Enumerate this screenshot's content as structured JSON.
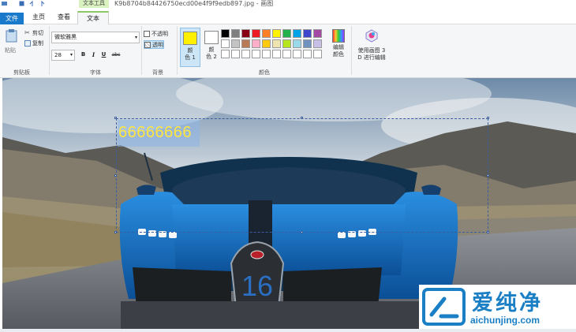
{
  "titlebar": {
    "context_tab_title": "文本工具",
    "document_title": "K9b8704b84426750ecd00e4f9f9edb897.jpg - 画图"
  },
  "tabs": [
    {
      "label": "文件"
    },
    {
      "label": "主页"
    },
    {
      "label": "查看"
    },
    {
      "label": "文本"
    }
  ],
  "clipboard": {
    "paste_label": "粘贴",
    "cut_label": "剪切",
    "copy_label": "复制",
    "group_label": "剪贴板"
  },
  "font": {
    "family_value": "微软雅黑",
    "size_value": "28",
    "bold_label": "B",
    "italic_label": "I",
    "underline_label": "U",
    "strike_label": "abc",
    "group_label": "字体"
  },
  "background": {
    "opaque_label": "不透明",
    "transparent_label": "透明",
    "group_label": "背景"
  },
  "colors": {
    "color1_label_top": "颜",
    "color1_label_bottom": "色 1",
    "color1_value": "#ffef00",
    "color2_label_top": "颜",
    "color2_label_bottom": "色 2",
    "color2_value": "#ffffff",
    "edit_colors_top": "编辑",
    "edit_colors_bottom": "颜色",
    "paint3d_top": "使用画图 3",
    "paint3d_bottom": "D 进行编辑",
    "group_label": "颜色",
    "palette_row1": [
      "#000000",
      "#7f7f7f",
      "#880015",
      "#ed1c24",
      "#ff7f27",
      "#fff200",
      "#22b14c",
      "#00a2e8",
      "#3f48cc",
      "#a349a4"
    ],
    "palette_row2": [
      "#ffffff",
      "#c3c3c3",
      "#b97a57",
      "#ffaec9",
      "#ffc90e",
      "#efe4b0",
      "#b5e61d",
      "#99d9ea",
      "#7092be",
      "#c8bfe7"
    ],
    "palette_row3": [
      "#ffffff",
      "#ffffff",
      "#ffffff",
      "#ffffff",
      "#ffffff",
      "#ffffff",
      "#ffffff",
      "#ffffff",
      "#ffffff",
      "#ffffff"
    ]
  },
  "canvas": {
    "text_content": "66666666",
    "car_number": "16"
  },
  "watermark": {
    "brand_cn": "爱纯净",
    "url": "aichunjing.com",
    "color": "#1a7fc4"
  }
}
